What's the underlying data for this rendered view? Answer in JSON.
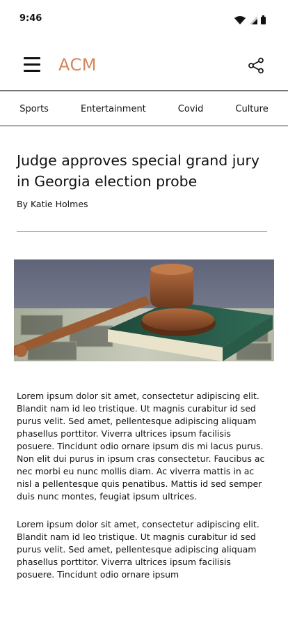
{
  "status": {
    "time": "9:46",
    "icons": [
      "wifi-icon",
      "cellular-signal-icon",
      "battery-icon"
    ]
  },
  "header": {
    "title": "ACM",
    "menu_icon": "hamburger-menu-icon",
    "share_icon": "share-icon",
    "accent_color": "#d4875c"
  },
  "categories": [
    "Sports",
    "Entertainment",
    "Covid",
    "Culture"
  ],
  "article": {
    "headline": "Judge approves special grand jury in Georgia election probe",
    "byline": "By Katie Holmes",
    "image_icon": "gavel-on-book-photo",
    "paragraphs": [
      "Lorem ipsum dolor sit amet, consectetur adipiscing elit. Blandit nam id leo tristique. Ut magnis curabitur id sed purus velit. Sed amet, pellentesque adipiscing aliquam phasellus porttitor. Viverra ultrices ipsum facilisis posuere. Tincidunt odio ornare ipsum dis mi lacus purus. Non elit dui purus in ipsum cras consectetur. Faucibus ac nec morbi eu nunc mollis diam. Ac viverra mattis in ac nisl a pellentesque quis penatibus. Mattis id sed semper duis nunc montes, feugiat ipsum ultrices.",
      "Lorem ipsum dolor sit amet, consectetur adipiscing elit. Blandit nam id leo tristique. Ut magnis curabitur id sed purus velit. Sed amet, pellentesque adipiscing aliquam phasellus porttitor. Viverra ultrices ipsum facilisis posuere. Tincidunt odio ornare ipsum"
    ]
  }
}
